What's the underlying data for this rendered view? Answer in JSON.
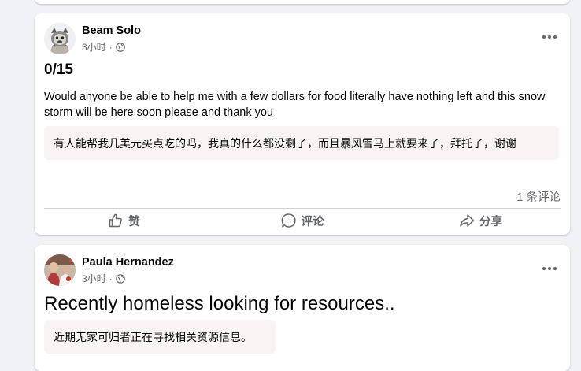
{
  "posts": [
    {
      "author": "Beam Solo",
      "time": "3小时",
      "separator": "·",
      "title": "0/15",
      "body": "Would anyone be able to help me with a few dollars for food literally have nothing left and this snow storm will be here soon please and thank you",
      "translation": "有人能帮我几美元买点吃的吗，我真的什么都没剩了，而且暴风雪马上就要来了，拜托了，谢谢",
      "comments": "1 条评论",
      "actions": {
        "like": "赞",
        "comment": "评论",
        "share": "分享"
      }
    },
    {
      "author": "Paula Hernandez",
      "time": "3小时",
      "separator": "·",
      "title": "Recently homeless looking for resources..",
      "translation": "近期无家可归者正在寻找相关资源信息。"
    }
  ],
  "icons": {
    "privacy": "globe-icon",
    "more": "more-options-icon",
    "like": "thumbs-up-icon",
    "comment": "comment-bubble-icon",
    "share": "share-arrow-icon"
  },
  "colors": {
    "background": "#f0f2f5",
    "card": "#ffffff",
    "secondary_text": "#65676b",
    "translation_bg": "#f7f4f3"
  }
}
